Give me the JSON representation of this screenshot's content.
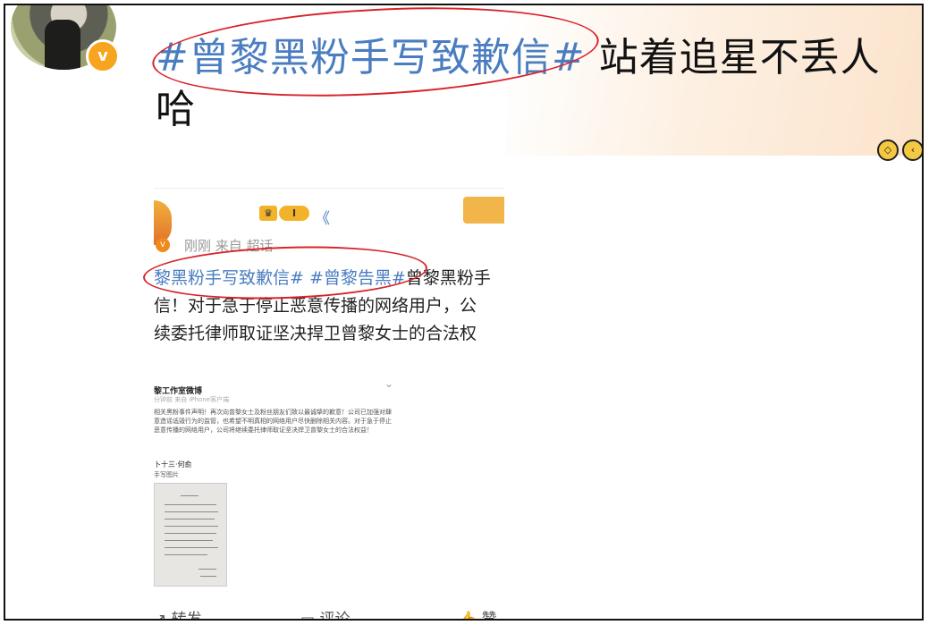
{
  "title": {
    "topic": "#曾黎黑粉手写致歉信#",
    "text_line1": " 站着追星不丢人",
    "text_line2": "哈"
  },
  "verified_badge": "v",
  "corner_icons": [
    "◇",
    "‹"
  ],
  "embedded_post": {
    "user_name": "",
    "level": "I",
    "tag_text": "《",
    "meta": "刚刚  来自 超话",
    "body_topics": "黎黑粉手写致歉信# #曾黎告黑#",
    "body_line1_rest": "曾黎黑粉手",
    "body_line2": "信！对于急于停止恶意传播的网络用户，公",
    "body_line3": "续委托律师取证坚决捍卫曾黎女士的合法权"
  },
  "inner_screenshot": {
    "name": "黎工作室微博",
    "meta": "分钟前  来自 iPhone客户端",
    "text": "相关黑粉事件声明！再次向曾黎女士及粉丝朋友们致以最诚挚的歉意！公司已加强对肆意造谣诋毁行为的监管，也希望不明真相的网络用户尽快删除相关内容。对于急于停止恶意传播的网络用户，公司将继续委托律师取证坚决捍卫曾黎女士的合法权益！",
    "user": "卜十三·何俞",
    "sub": "手写图片"
  },
  "actions": {
    "repost": "转发",
    "comment": "评论",
    "like": "赞"
  }
}
